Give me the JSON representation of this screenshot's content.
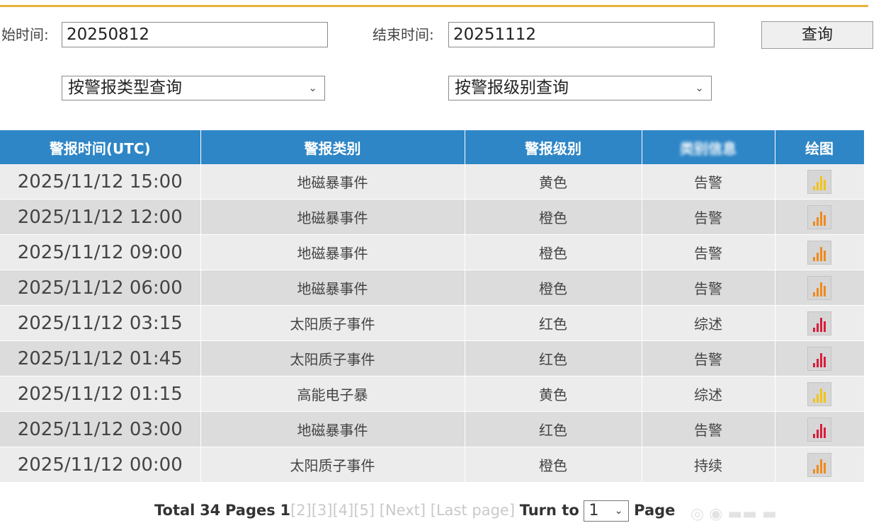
{
  "filters": {
    "start_label": "始时间:",
    "start_value": "20250812",
    "end_label": "结束时间:",
    "end_value": "20251112",
    "query_button": "查询",
    "type_select": "按警报类型查询",
    "level_select": "按警报级别查询"
  },
  "table": {
    "headers": [
      "警报时间(UTC)",
      "警报类别",
      "警报级别",
      "类别信息",
      "绘图"
    ],
    "rows": [
      {
        "time": "2025/11/12 15:00",
        "category": "地磁暴事件",
        "level": "黄色",
        "kind": "告警",
        "icon": "bar-chart-yellow-icon"
      },
      {
        "time": "2025/11/12 12:00",
        "category": "地磁暴事件",
        "level": "橙色",
        "kind": "告警",
        "icon": "bar-chart-orange-icon"
      },
      {
        "time": "2025/11/12 09:00",
        "category": "地磁暴事件",
        "level": "橙色",
        "kind": "告警",
        "icon": "bar-chart-orange-icon"
      },
      {
        "time": "2025/11/12 06:00",
        "category": "地磁暴事件",
        "level": "橙色",
        "kind": "告警",
        "icon": "bar-chart-orange-icon"
      },
      {
        "time": "2025/11/12 03:15",
        "category": "太阳质子事件",
        "level": "红色",
        "kind": "综述",
        "icon": "bar-chart-red-icon"
      },
      {
        "time": "2025/11/12 01:45",
        "category": "太阳质子事件",
        "level": "红色",
        "kind": "告警",
        "icon": "bar-chart-red-icon"
      },
      {
        "time": "2025/11/12 01:15",
        "category": "高能电子暴",
        "level": "黄色",
        "kind": "综述",
        "icon": "bar-chart-yellow-icon"
      },
      {
        "time": "2025/11/12 03:00",
        "category": "地磁暴事件",
        "level": "红色",
        "kind": "告警",
        "icon": "bar-chart-red-icon"
      },
      {
        "time": "2025/11/12 00:00",
        "category": "太阳质子事件",
        "level": "橙色",
        "kind": "持续",
        "icon": "bar-chart-orange-icon"
      }
    ]
  },
  "icon_colors": {
    "yellow": "#f2c418",
    "orange": "#f08a1c",
    "red": "#d81e3c"
  },
  "pager": {
    "total_label": "Total",
    "total_pages": "34",
    "pages_label": "Pages",
    "current": "1",
    "links": [
      "[2]",
      "[3]",
      "[4]",
      "[5]"
    ],
    "next": "[Next]",
    "last": "[Last page]",
    "turn_to": "Turn to",
    "selected_page": "1",
    "page_label": "Page"
  },
  "colors": {
    "accent_line": "#e8b33a",
    "header_bg": "#2e86c6"
  }
}
